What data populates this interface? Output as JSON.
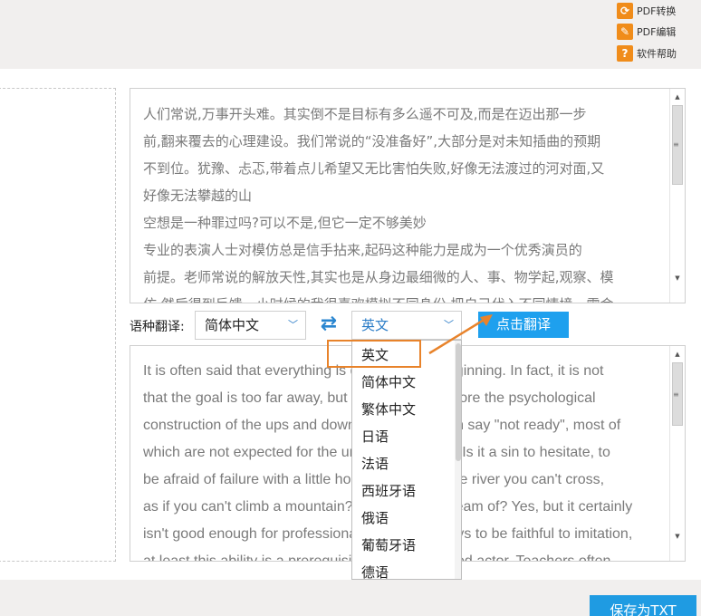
{
  "topbar": {
    "buttons": [
      {
        "label": "PDF转换",
        "icon": "refresh-icon"
      },
      {
        "label": "PDF编辑",
        "icon": "pencil-icon"
      },
      {
        "label": "软件帮助",
        "icon": "question-icon"
      }
    ]
  },
  "source_text": {
    "lines": [
      "人们常说,万事开头难。其实倒不是目标有多么遥不可及,而是在迈出那一步",
      "前,翻来覆去的心理建设。我们常说的“没准备好”,大部分是对未知插曲的预期",
      "不到位。犹豫、忐忑,带着点儿希望又无比害怕失败,好像无法渡过的河对面,又",
      "好像无法攀越的山",
      "空想是一种罪过吗?可以不是,但它一定不够美妙",
      "专业的表演人士对模仿总是信手拈来,起码这种能力是成为一个优秀演员的",
      "前提。老师常说的解放天性,其实也是从身边最细微的人、事、物学起,观察、模",
      "仿,然后得到反馈。小时候的我很喜欢模拟不同身份,把自己代入不同情境，需会"
    ]
  },
  "controls": {
    "language_label": "语种翻译:",
    "source_language": "简体中文",
    "target_language": "英文",
    "translate_button": "点击翻译"
  },
  "dropdown": {
    "options": [
      "英文",
      "简体中文",
      "繁体中文",
      "日语",
      "法语",
      "西班牙语",
      "俄语",
      "葡萄牙语",
      "德语"
    ]
  },
  "translated_text": {
    "lines": [
      "It is often said that everything is difficult at the beginning. In fact, it is not",
      "that the goal is too far away, but the repetition before the psychological",
      "construction of the ups and downs. What we often say \"not ready\", most of",
      "which are not expected for the unknown episode. Is it a sin to hesitate, to",
      "be afraid of failure with a little hope, like across the river you can't cross,",
      "as if you can't climb a mountain? What do you dream of? Yes, but it certainly",
      "isn't good enough for professionals who are always to be faithful to imitation,",
      "at least this ability is a prerequisite for being a good actor. Teachers often"
    ]
  },
  "footer": {
    "save_button": "保存为TXT"
  },
  "colors": {
    "accent_blue": "#1ea0ee",
    "highlight_orange": "#e8832b",
    "panel_gray": "#f1efee"
  }
}
